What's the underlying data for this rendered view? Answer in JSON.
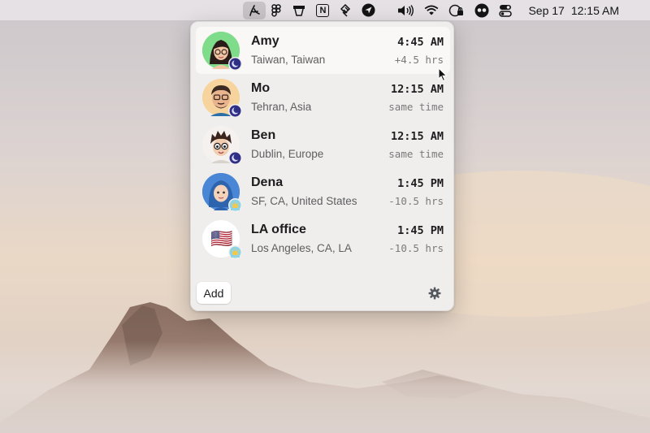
{
  "menubar": {
    "icons": [
      "timezone-app-icon",
      "figma-icon",
      "cup-icon",
      "notion-icon",
      "slack-like-icon",
      "location-arrow-icon",
      "volume-icon",
      "wifi-icon",
      "screen-lock-icon",
      "eyes-icon",
      "control-center-icon"
    ],
    "notion_glyph": "N",
    "date": "Sep 17",
    "time": "12:15 AM"
  },
  "people": [
    {
      "name": "Amy",
      "location": "Taiwan, Taiwan",
      "time": "4:45 AM",
      "diff": "+4.5 hrs",
      "badge": "moon",
      "avatar_bg": "#7fdc8a",
      "highlighted": true
    },
    {
      "name": "Mo",
      "location": "Tehran, Asia",
      "time": "12:15 AM",
      "diff": "same time",
      "badge": "moon",
      "avatar_bg": "#f7d49e"
    },
    {
      "name": "Ben",
      "location": "Dublin, Europe",
      "time": "12:15 AM",
      "diff": "same time",
      "badge": "moon",
      "avatar_bg": "#f4f1ee"
    },
    {
      "name": "Dena",
      "location": "SF, CA, United States",
      "time": "1:45 PM",
      "diff": "-10.5 hrs",
      "badge": "sun",
      "avatar_bg": "#4a86d6"
    },
    {
      "name": "LA office",
      "location": "Los Angeles, CA, LA",
      "time": "1:45 PM",
      "diff": "-10.5 hrs",
      "badge": "sun",
      "avatar_bg": "#ffffff",
      "flag": "🇺🇸"
    }
  ],
  "footer": {
    "add_label": "Add",
    "settings_icon": "gear-icon"
  }
}
